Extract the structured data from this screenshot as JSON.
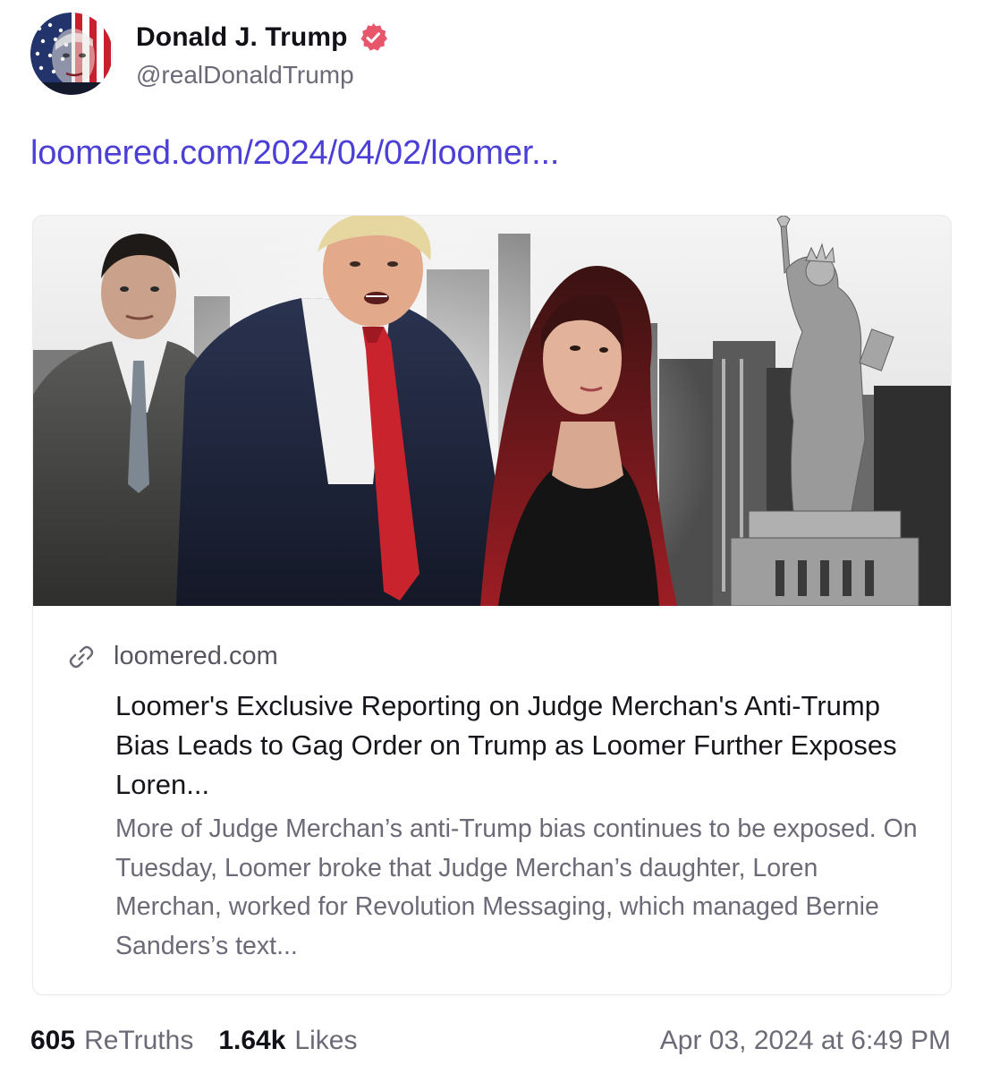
{
  "author": {
    "display_name": "Donald J. Trump",
    "handle": "@realDonaldTrump",
    "avatar_icon": "flag-face-avatar",
    "verified_icon": "verified-badge-icon",
    "verified_color": "#e8566b"
  },
  "post": {
    "link_text": "loomered.com/2024/04/02/loomer...",
    "link_color": "#4b3fd6"
  },
  "card": {
    "image_description_icon": "article-preview-image",
    "domain_icon": "link-icon",
    "domain": "loomered.com",
    "title": "Loomer's Exclusive Reporting on Judge Merchan's Anti-Trump Bias Leads to Gag Order on Trump as Loomer Further Exposes Loren...",
    "description": "More of Judge Merchan’s anti-Trump bias continues to be exposed. On Tuesday, Loomer broke that Judge Merchan’s daughter, Loren Merchan, worked for Revolution Messaging, which managed Bernie Sanders’s text..."
  },
  "stats": {
    "retruths_count": "605",
    "retruths_label": "ReTruths",
    "likes_count": "1.64k",
    "likes_label": "Likes",
    "timestamp": "Apr 03, 2024 at 6:49 PM"
  }
}
